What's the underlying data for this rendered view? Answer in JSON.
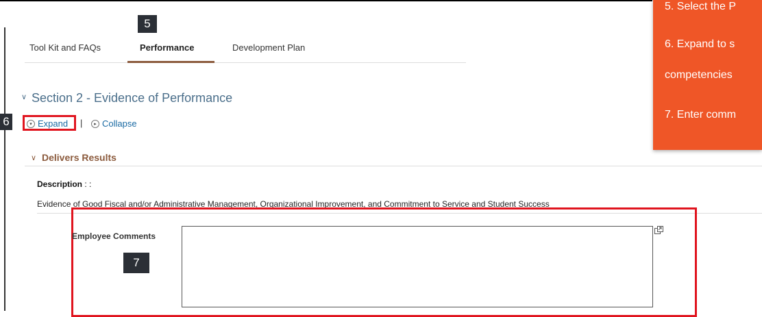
{
  "tabs": [
    {
      "label": "Tool Kit and FAQs",
      "active": false
    },
    {
      "label": "Performance",
      "active": true
    },
    {
      "label": "Development Plan",
      "active": false
    }
  ],
  "markers": {
    "step5": "5",
    "step6": "6",
    "step7": "7"
  },
  "section": {
    "title": "Section 2 - Evidence of Performance"
  },
  "controls": {
    "expand_label": "Expand",
    "separator": "|",
    "collapse_label": "Collapse"
  },
  "group": {
    "title": "Delivers Results",
    "description_label": "Description",
    "description_suffix": " : :",
    "description_text": "Evidence of Good Fiscal and/or Administrative Management, Organizational Improvement, and Commitment to Service and Student Success"
  },
  "comments": {
    "label": "Employee Comments",
    "value": ""
  },
  "instructions": {
    "line1": "5. Select the P",
    "line2": "6. Expand to s",
    "line3": "competencies",
    "line4": "7. Enter comm"
  },
  "colors": {
    "accent_orange": "#ef5627",
    "highlight_red": "#e0141e",
    "tab_underline": "#8b5a3c",
    "link": "#1a6aa3"
  }
}
